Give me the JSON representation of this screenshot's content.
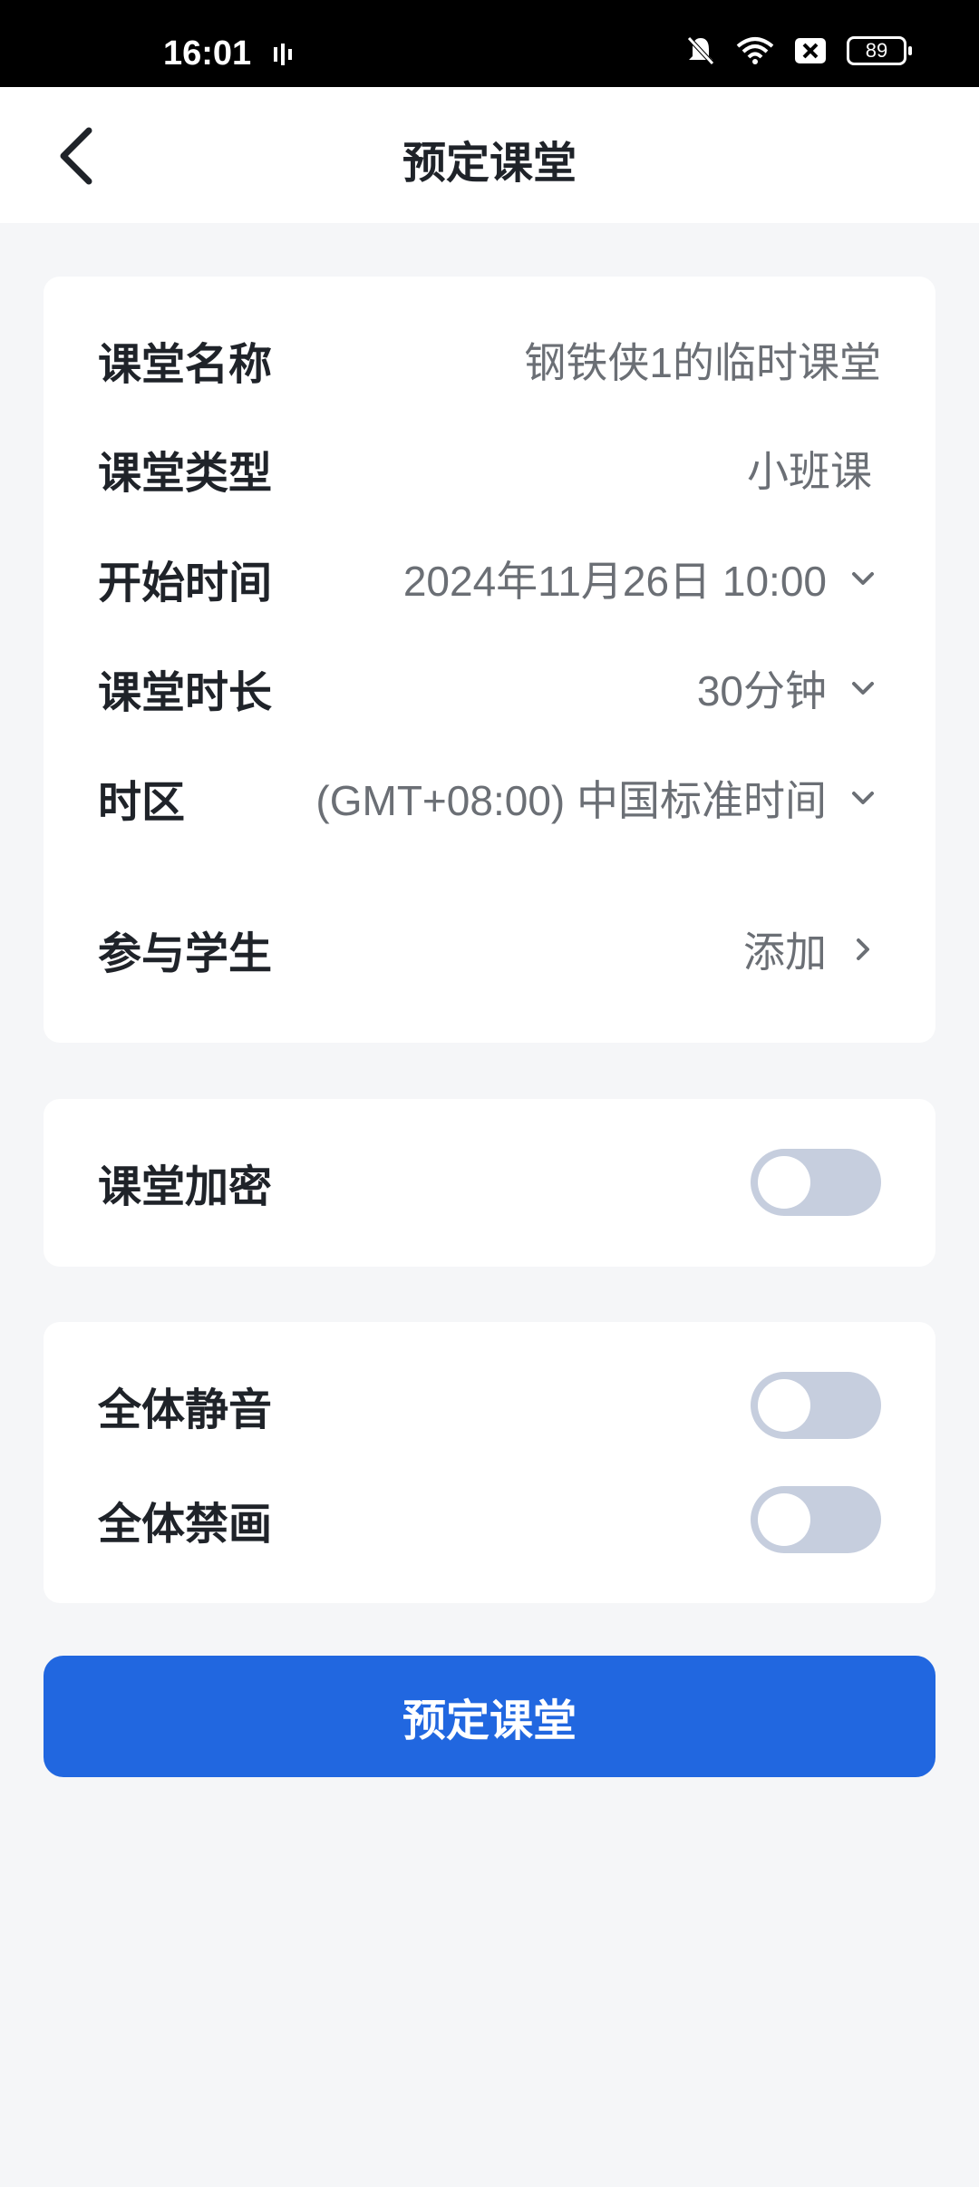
{
  "status_bar": {
    "time": "16:01",
    "battery": "89",
    "icons": [
      "signal-icon",
      "mute-icon",
      "wifi-icon",
      "sim-off-icon",
      "battery-icon"
    ]
  },
  "header": {
    "title": "预定课堂",
    "back_icon": "chevron-left-icon"
  },
  "form": {
    "class_name": {
      "label": "课堂名称",
      "value": "钢铁侠1的临时课堂"
    },
    "class_type": {
      "label": "课堂类型",
      "value": "小班课"
    },
    "start_time": {
      "label": "开始时间",
      "value": "2024年11月26日 10:00"
    },
    "duration": {
      "label": "课堂时长",
      "value": "30分钟"
    },
    "timezone": {
      "label": "时区",
      "value": "(GMT+08:00) 中国标准时间"
    },
    "students": {
      "label": "参与学生",
      "value": "添加"
    }
  },
  "settings": {
    "encrypt": {
      "label": "课堂加密",
      "on": false
    },
    "mute_all": {
      "label": "全体静音",
      "on": false
    },
    "disable_draw": {
      "label": "全体禁画",
      "on": false
    }
  },
  "submit_label": "预定课堂",
  "colors": {
    "accent": "#2167e0",
    "toggle_off": "#c6cede",
    "background": "#f5f6f8"
  }
}
